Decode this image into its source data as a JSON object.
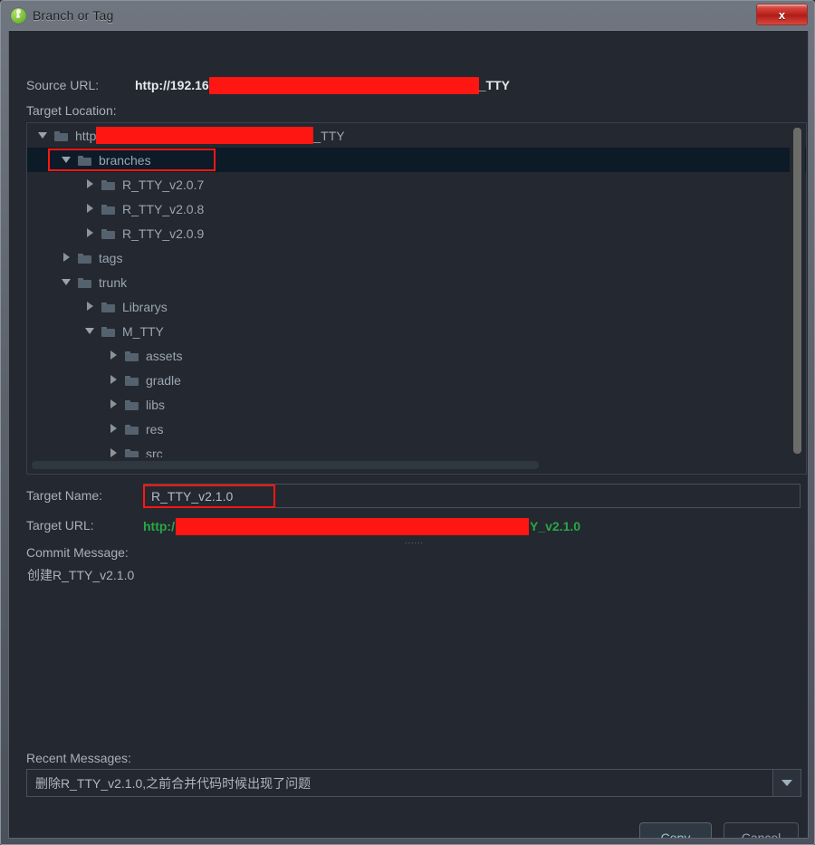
{
  "window": {
    "title": "Branch or Tag",
    "app_icon": "android-studio-icon",
    "close_label": "x"
  },
  "form": {
    "source_url_label": "Source URL:",
    "source_url_prefix": "http://192.16",
    "source_url_suffix": "_TTY",
    "target_location_label": "Target Location:",
    "target_name_label": "Target Name:",
    "target_name_value": "R_TTY_v2.1.0",
    "target_url_label": "Target URL:",
    "target_url_prefix": "http:/",
    "target_url_suffix": "Y_v2.1.0",
    "target_url_dots": "......",
    "commit_message_label": "Commit Message:",
    "commit_message_value": "创建R_TTY_v2.1.0",
    "recent_messages_label": "Recent Messages:",
    "recent_messages_value": "删除R_TTY_v2.1.0,之前合并代码时候出现了问题",
    "dropdown_icon": "chevron-down-icon"
  },
  "tree": {
    "rows": [
      {
        "label_prefix": "http",
        "label_suffix": "_TTY",
        "redacted": true,
        "indent": 0,
        "state": "open",
        "selected": false
      },
      {
        "label": "branches",
        "indent": 1,
        "state": "open",
        "selected": true,
        "annotated": true
      },
      {
        "label": "R_TTY_v2.0.7",
        "indent": 2,
        "state": "closed",
        "selected": false
      },
      {
        "label": "R_TTY_v2.0.8",
        "indent": 2,
        "state": "closed",
        "selected": false
      },
      {
        "label": "R_TTY_v2.0.9",
        "indent": 2,
        "state": "closed",
        "selected": false
      },
      {
        "label": "tags",
        "indent": 1,
        "state": "closed",
        "selected": false
      },
      {
        "label": "trunk",
        "indent": 1,
        "state": "open",
        "selected": false
      },
      {
        "label": "Librarys",
        "indent": 2,
        "state": "closed",
        "selected": false
      },
      {
        "label": "M_TTY",
        "indent": 2,
        "state": "open",
        "selected": false
      },
      {
        "label": "assets",
        "indent": 3,
        "state": "closed",
        "selected": false
      },
      {
        "label": "gradle",
        "indent": 3,
        "state": "closed",
        "selected": false
      },
      {
        "label": "libs",
        "indent": 3,
        "state": "closed",
        "selected": false
      },
      {
        "label": "res",
        "indent": 3,
        "state": "closed",
        "selected": false
      },
      {
        "label": "src",
        "indent": 3,
        "state": "closed",
        "selected": false
      }
    ]
  },
  "buttons": {
    "copy_label": "Copy",
    "cancel_label": "Cancel"
  },
  "colors": {
    "background": "#242830",
    "selection": "#0d1a27",
    "redaction": "#fe1712",
    "annotation": "#fe1712",
    "url_green": "#27a844",
    "accent_button_text": "#9fc5d6"
  }
}
